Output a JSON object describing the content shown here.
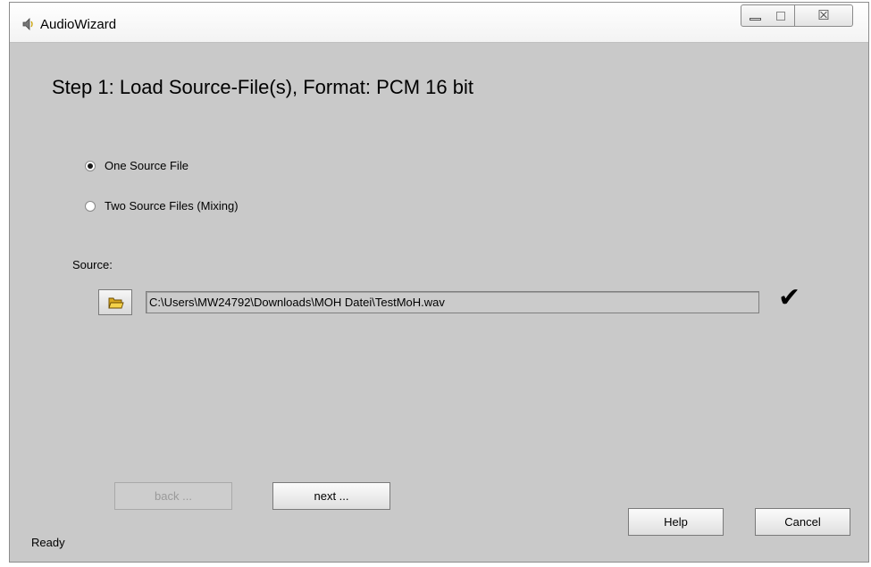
{
  "window": {
    "title": "AudioWizard",
    "close_glyph": "☒",
    "icons": {
      "app": "speaker-icon",
      "minimize": "minimize-icon",
      "maximize": "maximize-icon",
      "close": "close-icon"
    }
  },
  "step": {
    "heading": "Step 1: Load Source-File(s), Format: PCM 16 bit"
  },
  "options": [
    {
      "label": "One Source File",
      "checked": true
    },
    {
      "label": "Two Source Files (Mixing)",
      "checked": false
    }
  ],
  "source": {
    "label": "Source:",
    "path": "C:\\Users\\MW24792\\Downloads\\MOH Datei\\TestMoH.wav",
    "browse_icon": "folder-open-icon",
    "status_icon": "checkmark-icon",
    "status_glyph": "✔"
  },
  "buttons": {
    "back": "back ...",
    "next": "next ...",
    "help": "Help",
    "cancel": "Cancel"
  },
  "status_bar": {
    "text": "Ready"
  },
  "colors": {
    "window_bg": "#c9c9c9",
    "titlebar_bg": "#ffffff"
  }
}
